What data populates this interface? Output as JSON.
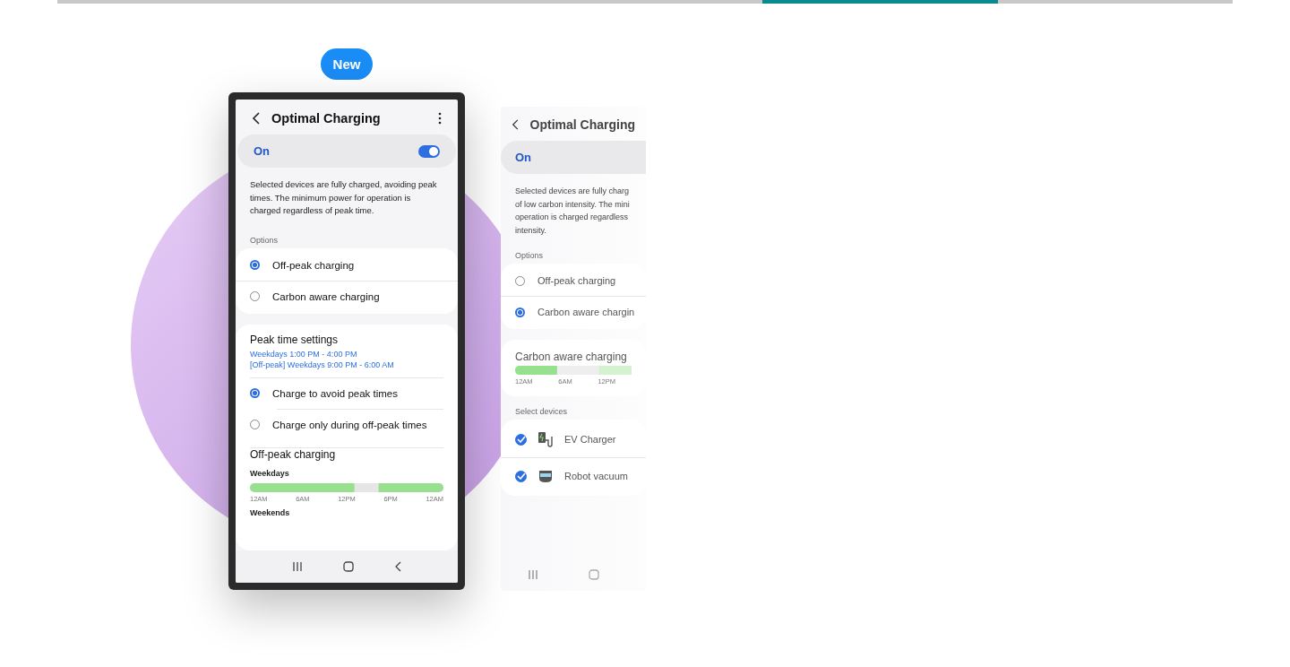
{
  "slides": [
    {
      "selected": false
    },
    {
      "selected": false
    },
    {
      "selected": false
    },
    {
      "selected": true
    },
    {
      "selected": false
    }
  ],
  "badge": "New",
  "phone": {
    "title": "Optimal Charging",
    "switch": {
      "label": "On",
      "on": true
    },
    "description": "Selected devices are fully charged, avoiding peak times. The minimum power for operation is charged regardless of peak time.",
    "options_label": "Options",
    "options": [
      {
        "label": "Off-peak charging",
        "selected": true
      },
      {
        "label": "Carbon aware charging",
        "selected": false
      }
    ],
    "peak": {
      "title": "Peak time settings",
      "lines": [
        "Weekdays 1:00 PM - 4:00 PM",
        "[Off-peak] Weekdays 9:00 PM - 6:00 AM"
      ]
    },
    "modes": [
      {
        "label": "Charge to avoid peak times",
        "selected": true
      },
      {
        "label": "Charge only during off-peak times",
        "selected": false
      }
    ],
    "offpeak": {
      "title": "Off-peak charging",
      "weekdays": "Weekdays",
      "ticks": [
        "12AM",
        "6AM",
        "12PM",
        "6PM",
        "12AM"
      ],
      "weekends": "Weekends"
    }
  },
  "preview": {
    "title": "Optimal Charging",
    "switch_label": "On",
    "description_lines": [
      "Selected devices are fully charg",
      "of low carbon intensity. The mini",
      "operation is charged regardless",
      "intensity."
    ],
    "options_label": "Options",
    "options": [
      {
        "label": "Off-peak charging",
        "selected": false
      },
      {
        "label": "Carbon aware chargin",
        "selected": true
      }
    ],
    "carbon": {
      "title": "Carbon aware charging",
      "ticks": [
        "12AM",
        "6AM",
        "12PM"
      ]
    },
    "devices_label": "Select devices",
    "devices": [
      {
        "label": "EV Charger",
        "kind": "ev",
        "checked": true
      },
      {
        "label": "Robot vacuum",
        "kind": "vacuum",
        "checked": true
      }
    ]
  }
}
